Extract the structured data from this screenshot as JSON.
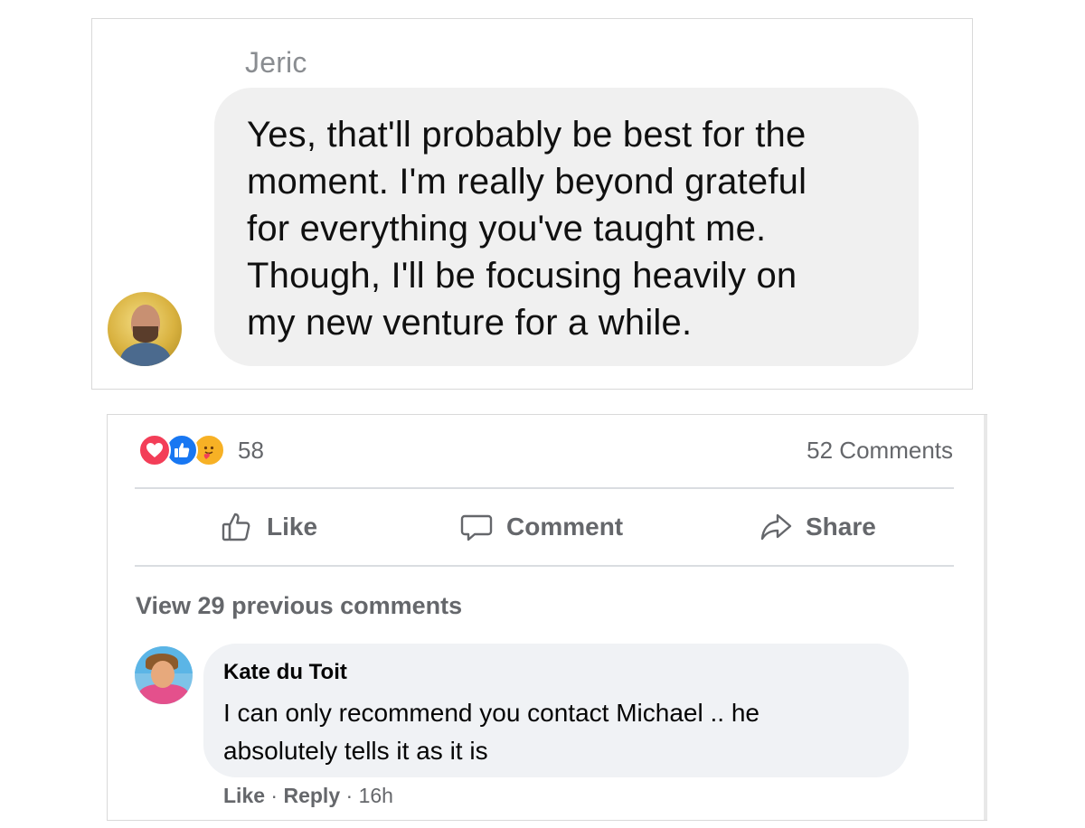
{
  "message": {
    "sender": "Jeric",
    "text": "Yes, that'll probably be best for the moment. I'm really beyond grateful for everything you've taught me. Though, I'll be focusing heavily on my new venture for a while.",
    "lines": [
      "Yes, that'll probably be best for the",
      "moment. I'm really beyond grateful",
      "for everything you've taught me.",
      "Though, I'll be focusing heavily on",
      "my new venture for a while."
    ]
  },
  "post": {
    "reactions": {
      "icons": [
        "love-reaction-icon",
        "like-reaction-icon",
        "care-reaction-icon"
      ],
      "count": "58"
    },
    "comments_count": "52 Comments",
    "actions": {
      "like": "Like",
      "comment": "Comment",
      "share": "Share"
    },
    "view_previous": "View 29 previous comments",
    "comment": {
      "author": "Kate du Toit",
      "lines": [
        "I can only recommend you contact Michael .. he",
        "absolutely tells it as it is"
      ],
      "like": "Like",
      "separator1": " · ",
      "reply": "Reply",
      "separator2": " · ",
      "time": "16h"
    }
  },
  "colors": {
    "bubble_bg": "#f0f0f0",
    "comment_bg": "#f0f2f5",
    "secondary_text": "#65676b",
    "love": "#f33e58",
    "like": "#1877f2",
    "care": "#f7b125"
  }
}
